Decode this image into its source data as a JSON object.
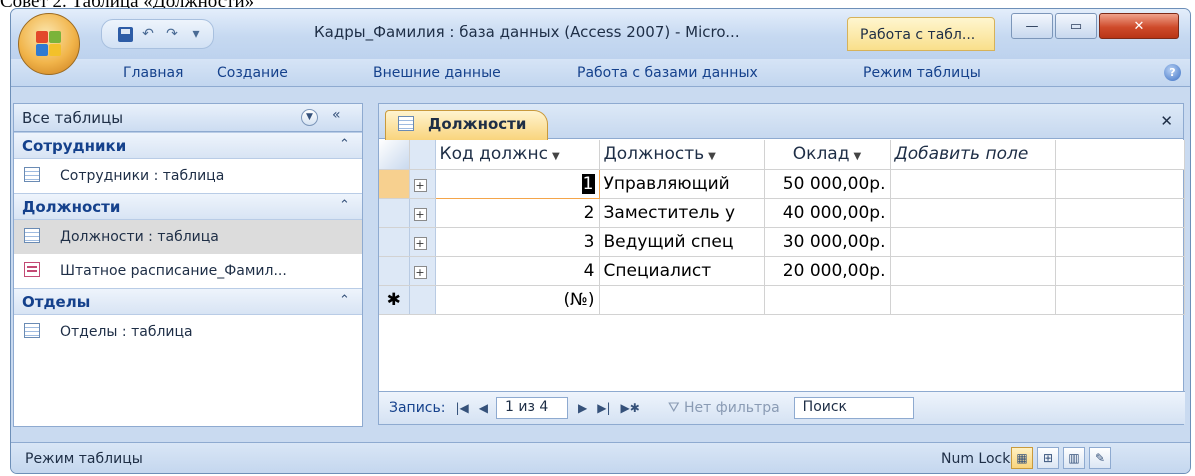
{
  "caption": "Совет 2. Таблица «Должности»",
  "window": {
    "title": "Кадры_Фамилия : база данных (Access 2007) - Micro...",
    "context_tab": "Работа с табл..."
  },
  "ribbon": {
    "tabs": [
      "Главная",
      "Создание",
      "Внешние данные",
      "Работа с базами данных",
      "Режим таблицы"
    ]
  },
  "nav": {
    "header": "Все таблицы",
    "groups": [
      {
        "name": "Сотрудники",
        "items": [
          {
            "label": "Сотрудники : таблица",
            "icon": "table-icon"
          }
        ]
      },
      {
        "name": "Должности",
        "items": [
          {
            "label": "Должности : таблица",
            "icon": "table-icon",
            "selected": true
          },
          {
            "label": "Штатное расписание_Фамил...",
            "icon": "form-icon"
          }
        ]
      },
      {
        "name": "Отделы",
        "items": [
          {
            "label": "Отделы : таблица",
            "icon": "table-icon"
          }
        ]
      }
    ]
  },
  "doc": {
    "tab_label": "Должности",
    "columns": [
      "Код должнс",
      "Должность",
      "Оклад",
      "Добавить поле"
    ],
    "rows": [
      {
        "code": "1",
        "title": "Управляющий",
        "salary": "50 000,00р."
      },
      {
        "code": "2",
        "title": "Заместитель у",
        "salary": "40 000,00р."
      },
      {
        "code": "3",
        "title": "Ведущий спец",
        "salary": "30 000,00р."
      },
      {
        "code": "4",
        "title": "Специалист",
        "salary": "20 000,00р."
      }
    ],
    "new_row_code": "(№)",
    "new_row_marker": "✱"
  },
  "record_nav": {
    "label": "Запись:",
    "counter": "1 из 4",
    "filter": "Нет фильтра",
    "search": "Поиск"
  },
  "status": {
    "mode": "Режим таблицы",
    "numlock": "Num Lock"
  }
}
